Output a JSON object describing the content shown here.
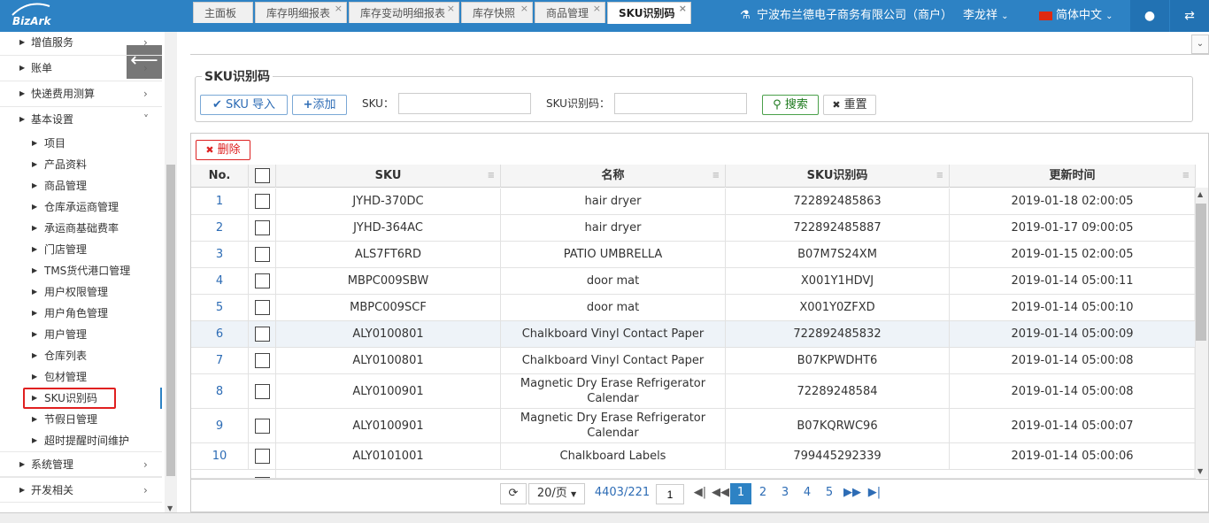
{
  "topbar": {
    "logo": "BizArk",
    "company": "宁波布兰德电子商务有限公司（商户）",
    "user": "李龙祥",
    "language": "简体中文"
  },
  "sidebar": {
    "top_items": [
      "增值服务",
      "账单",
      "快递费用测算",
      "基本设置"
    ],
    "sub_items": [
      "项目",
      "产品资料",
      "商品管理",
      "仓库承运商管理",
      "承运商基础费率",
      "门店管理",
      "TMS货代港口管理",
      "用户权限管理",
      "用户角色管理",
      "用户管理",
      "仓库列表",
      "包材管理",
      "SKU识别码",
      "节假日管理",
      "超时提醒时间维护"
    ],
    "bottom_items": [
      "系统管理",
      "开发相关"
    ]
  },
  "tabs": [
    "主面板",
    "库存明细报表",
    "库存变动明细报表",
    "库存快照",
    "商品管理",
    "SKU识别码"
  ],
  "search": {
    "legend": "SKU识别码",
    "import_btn": "SKU 导入",
    "add_btn": "添加",
    "sku_label": "SKU：",
    "code_label": "SKU识别码：",
    "sku_value": "",
    "code_value": "",
    "search_btn": "搜索",
    "reset_btn": "重置"
  },
  "toolbar": {
    "delete_btn": "删除"
  },
  "table": {
    "headers": [
      "No.",
      "",
      "SKU",
      "名称",
      "SKU识别码",
      "更新时间"
    ],
    "rows": [
      {
        "no": "1",
        "sku": "JYHD-370DC",
        "name": "hair dryer",
        "code": "722892485863",
        "time": "2019-01-18 02:00:05"
      },
      {
        "no": "2",
        "sku": "JYHD-364AC",
        "name": "hair dryer",
        "code": "722892485887",
        "time": "2019-01-17 09:00:05"
      },
      {
        "no": "3",
        "sku": "ALS7FT6RD",
        "name": "PATIO UMBRELLA",
        "code": "B07M7S24XM",
        "time": "2019-01-15 02:00:05"
      },
      {
        "no": "4",
        "sku": "MBPC009SBW",
        "name": "door mat",
        "code": "X001Y1HDVJ",
        "time": "2019-01-14 05:00:11"
      },
      {
        "no": "5",
        "sku": "MBPC009SCF",
        "name": "door mat",
        "code": "X001Y0ZFXD",
        "time": "2019-01-14 05:00:10"
      },
      {
        "no": "6",
        "sku": "ALY0100801",
        "name": "Chalkboard Vinyl Contact Paper",
        "code": "722892485832",
        "time": "2019-01-14 05:00:09"
      },
      {
        "no": "7",
        "sku": "ALY0100801",
        "name": "Chalkboard Vinyl Contact Paper",
        "code": "B07KPWDHT6",
        "time": "2019-01-14 05:00:08"
      },
      {
        "no": "8",
        "sku": "ALY0100901",
        "name": "Magnetic Dry Erase Refrigerator Calendar",
        "code": "72289248584",
        "time": "2019-01-14 05:00:08"
      },
      {
        "no": "9",
        "sku": "ALY0100901",
        "name": "Magnetic Dry Erase Refrigerator Calendar",
        "code": "B07KQRWC96",
        "time": "2019-01-14 05:00:07"
      },
      {
        "no": "10",
        "sku": "ALY0101001",
        "name": "Chalkboard Labels",
        "code": "799445292339",
        "time": "2019-01-14 05:00:06"
      }
    ]
  },
  "pager": {
    "page_size": "20/页",
    "total": "4403/221",
    "current_input": "1",
    "pages": [
      "1",
      "2",
      "3",
      "4",
      "5"
    ]
  }
}
